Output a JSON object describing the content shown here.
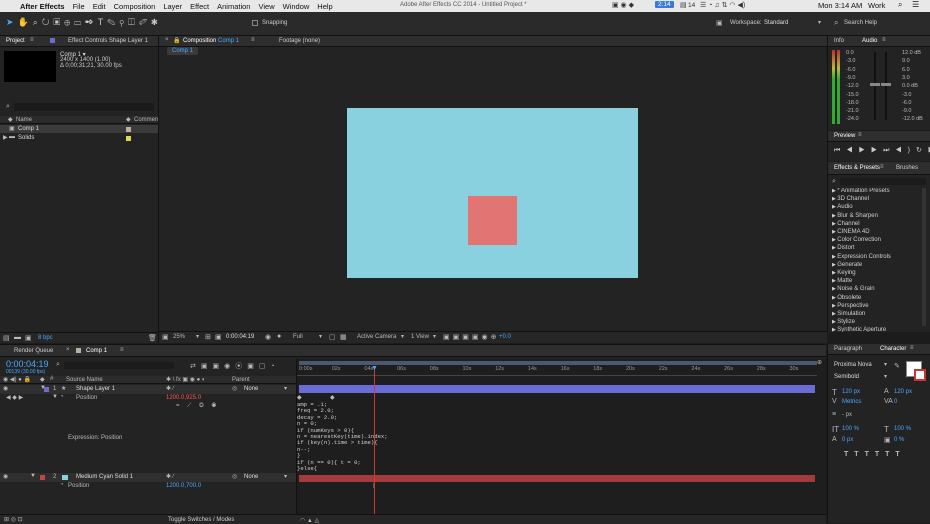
{
  "menubar": {
    "app_name": "After Effects",
    "items": [
      "File",
      "Edit",
      "Composition",
      "Layer",
      "Effect",
      "Animation",
      "View",
      "Window",
      "Help"
    ],
    "window_title": "Adobe After Effects CC 2014 - Untitled Project *",
    "battery_badge": "2:14",
    "clock": "Mon 3:14 AM",
    "user": "Work",
    "notify_count": "14"
  },
  "toolbar": {
    "snapping": "Snapping",
    "workspace_label": "Workspace:",
    "workspace_value": "Standard",
    "search_placeholder": "Search Help"
  },
  "project": {
    "tab_project": "Project",
    "tab_effect_controls": "Effect Controls Shape Layer 1",
    "comp_name": "Comp 1 ▾",
    "comp_size": "2400 x 1400 (1.00)",
    "comp_duration": "Δ 0;00;31;21, 30.00 fps",
    "col_name": "Name",
    "col_comment": "Comment",
    "items": [
      {
        "name": "Comp 1",
        "color": "#b9b0a4"
      },
      {
        "name": "Solids",
        "color": "#e3d64a"
      }
    ],
    "bpc": "8 bpc"
  },
  "composition": {
    "tab_label": "Composition",
    "tab_comp": "Comp 1",
    "footage_tab": "Footage (none)",
    "comp_chip": "Comp 1",
    "zoom": "25%",
    "timecode": "0:00:04:19",
    "resolution": "Full",
    "camera": "Active Camera",
    "view": "1 View",
    "exposure": "+0.0",
    "bg_color": "#8ad1df",
    "square_color": "#e37474"
  },
  "right_panels": {
    "info_tab": "Info",
    "audio_tab": "Audio",
    "audio_left": [
      "0.0",
      "-3.0",
      "-6.0",
      "-9.0",
      "-12.0",
      "-15.0",
      "-18.0",
      "-21.0",
      "-24.0"
    ],
    "audio_right": [
      "12.0 dB",
      "9.0",
      "6.0",
      "3.0",
      "0.0 dB",
      "-3.0",
      "-6.0",
      "-9.0",
      "-12.0 dB"
    ],
    "preview_tab": "Preview",
    "effects_tab": "Effects & Presets",
    "brushes_tab": "Brushes",
    "effects": [
      "* Animation Presets",
      "3D Channel",
      "Audio",
      "Blur & Sharpen",
      "Channel",
      "CINEMA 4D",
      "Color Correction",
      "Distort",
      "Expression Controls",
      "Generate",
      "Keying",
      "Matte",
      "Noise & Grain",
      "Obsolete",
      "Perspective",
      "Simulation",
      "Stylize",
      "Synthetic Aperture"
    ],
    "paragraph_tab": "Paragraph",
    "character_tab": "Character",
    "font_family": "Proxima Nova",
    "font_style": "Semibold",
    "font_size": "120 px",
    "leading": "120 px",
    "kerning": "Metrics",
    "tracking": "0",
    "stroke_width": "- px",
    "vert_scale": "100 %",
    "horiz_scale": "100 %",
    "baseline": "0 px",
    "tsume": "0 %"
  },
  "timeline": {
    "render_queue_tab": "Render Queue",
    "comp_tab": "Comp 1",
    "timecode": "0:00:04:19",
    "frames": "00139 (30.00 fps)",
    "col_source": "Source Name",
    "col_parent": "Parent",
    "layers": [
      {
        "num": "1",
        "name": "Shape Layer 1",
        "parent": "None",
        "color": "#6b6bd8"
      },
      {
        "num": "2",
        "name": "Medium Cyan Solid 1",
        "parent": "None",
        "color": "#c84444"
      }
    ],
    "position_label": "Position",
    "position_value_1": "1200.0,925.0",
    "position_value_2": "1200.0,700.0",
    "expression_label": "Expression: Position",
    "ruler": [
      "0:00s",
      "02s",
      "04s",
      "06s",
      "08s",
      "10s",
      "12s",
      "14s",
      "16s",
      "18s",
      "20s",
      "22s",
      "24s",
      "26s",
      "28s",
      "30s"
    ],
    "code": [
      "amp = .1;",
      "freq = 2.0;",
      "decay = 2.0;",
      "n = 0;",
      "if (numKeys > 0){",
      "n = nearestKey(time).index;",
      "if (key(n).time > time){",
      "n--;",
      "}",
      "if (n == 0){ t = 0;",
      "}else{"
    ],
    "toggle_label": "Toggle Switches / Modes"
  }
}
